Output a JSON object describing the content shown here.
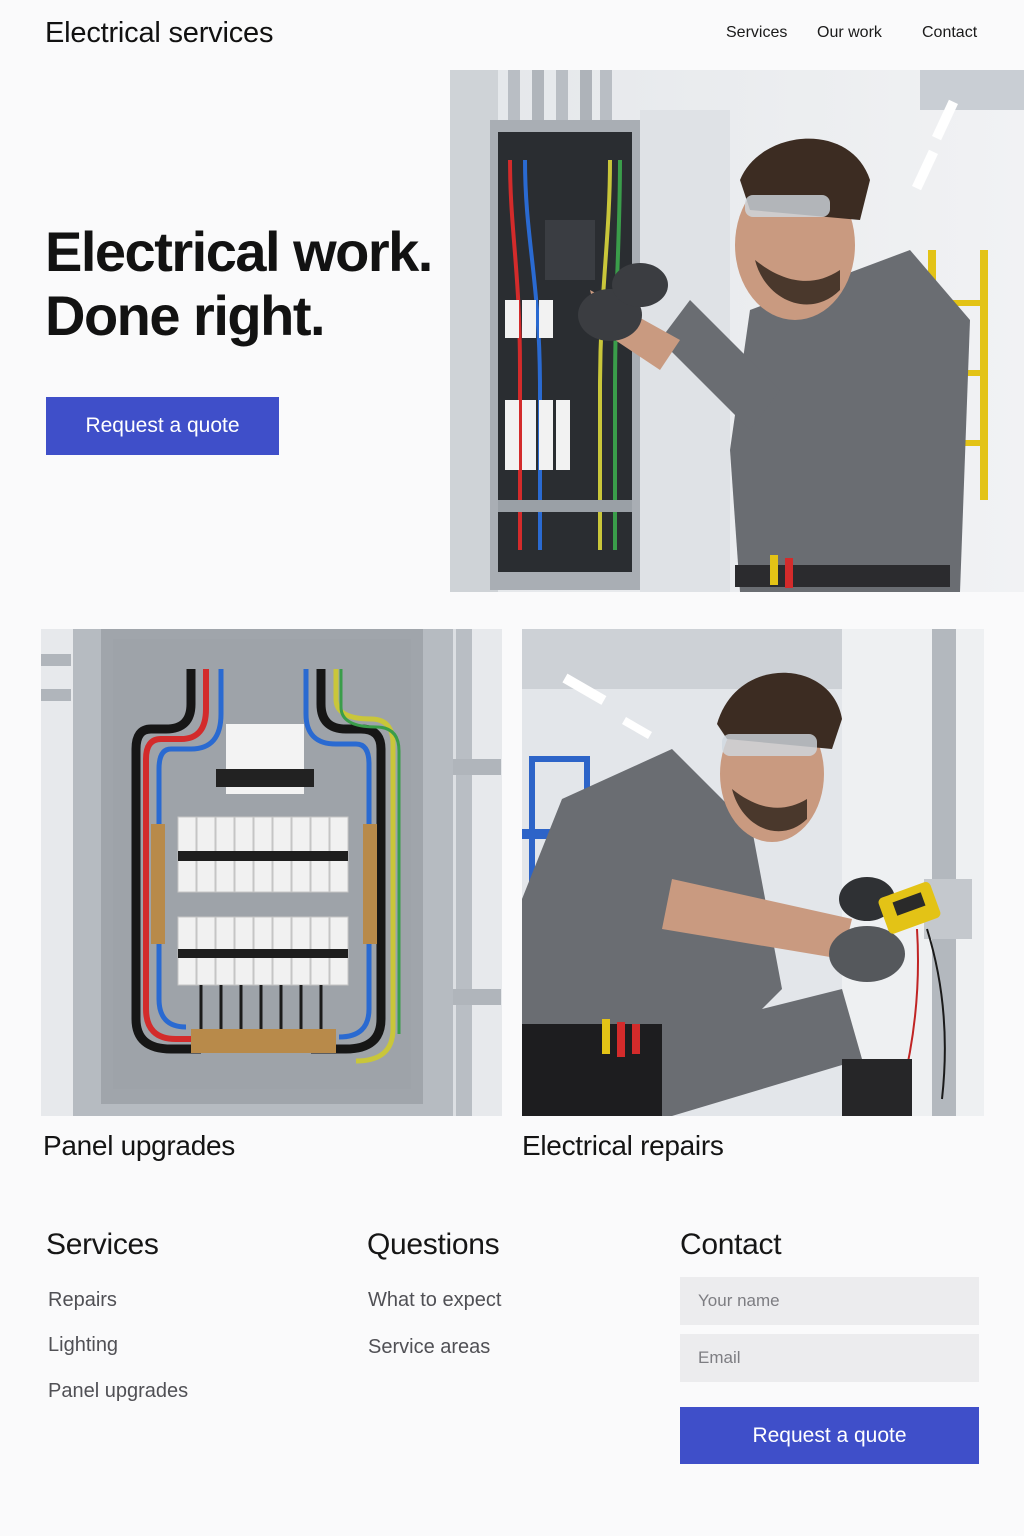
{
  "header": {
    "site_title": "Electrical services",
    "nav": {
      "services": "Services",
      "our_work": "Our work",
      "contact": "Contact"
    }
  },
  "hero": {
    "heading_line1": "Electrical work.",
    "heading_line2": "Done right.",
    "cta_label": "Request a quote"
  },
  "cards": [
    {
      "title": "Panel upgrades"
    },
    {
      "title": "Electrical repairs"
    }
  ],
  "footer": {
    "services": {
      "heading": "Services",
      "links": [
        "Repairs",
        "Lighting",
        "Panel upgrades"
      ]
    },
    "questions": {
      "heading": "Questions",
      "links": [
        "What to expect",
        "Service areas"
      ]
    },
    "contact": {
      "heading": "Contact",
      "name_placeholder": "Your name",
      "email_placeholder": "Email",
      "cta_label": "Request a quote"
    }
  },
  "colors": {
    "accent": "#3f4fc9",
    "background": "#fafafb",
    "input_background": "#ececee"
  }
}
